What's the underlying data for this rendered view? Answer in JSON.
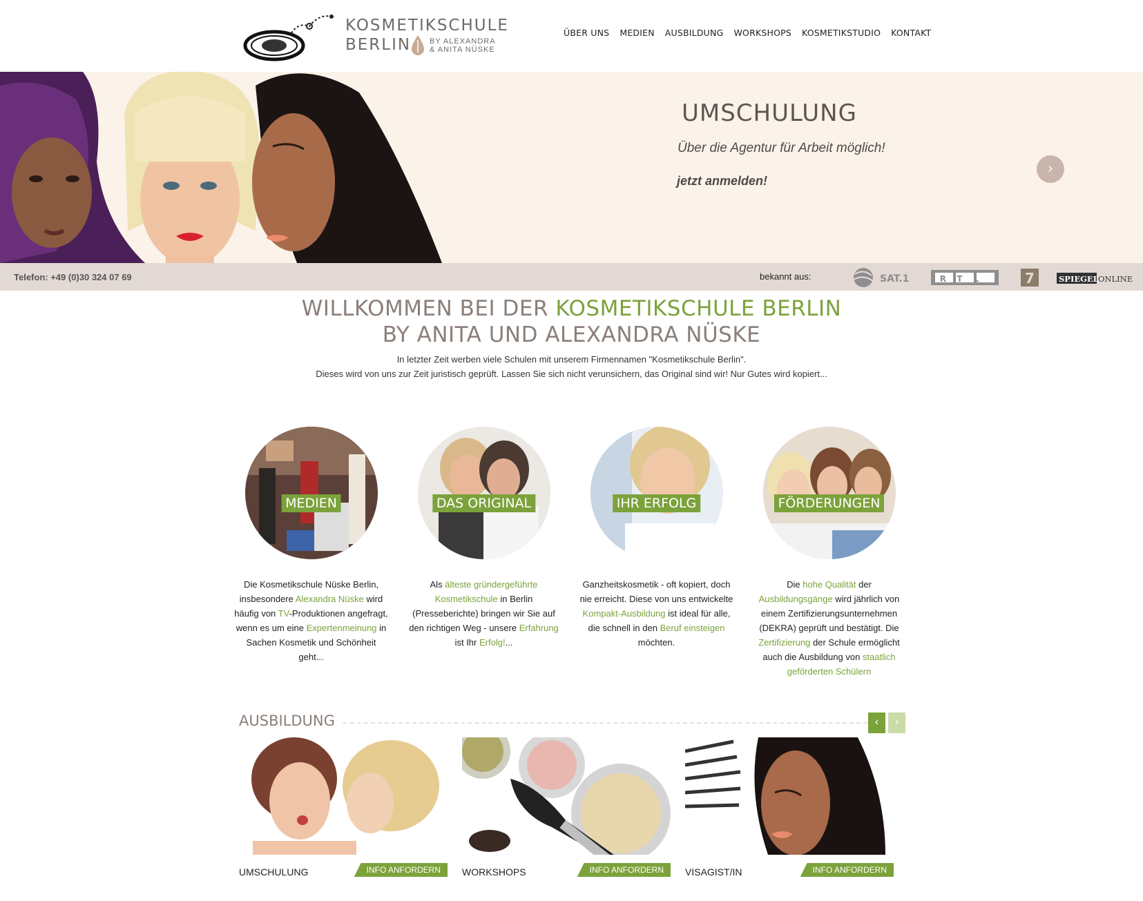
{
  "header": {
    "logo_title": "KOSMETIKSCHULE",
    "logo_city": "BERLIN",
    "logo_by_line1": "BY ALEXANDRA",
    "logo_by_line2": "& ANITA NÜSKE",
    "nav": [
      "ÜBER UNS",
      "MEDIEN",
      "AUSBILDUNG",
      "WORKSHOPS",
      "KOSMETIKSTUDIO",
      "KONTAKT"
    ]
  },
  "hero": {
    "title": "UMSCHULUNG",
    "subtitle": "Über die Agentur für Arbeit möglich!",
    "cta": "jetzt anmelden!",
    "next_icon": "chevron-right-icon"
  },
  "infobar": {
    "phone": "Telefon: +49 (0)30 324 07 69",
    "known_from": "bekannt aus:",
    "media": [
      "SAT.1",
      "RTL",
      "7",
      "SPIEGEL",
      "ONLINE"
    ]
  },
  "welcome": {
    "title_part1": "WILLKOMMEN BEI DER ",
    "title_part2": "KOSMETIKSCHULE BERLIN",
    "title_line2": "BY ANITA UND ALEXANDRA NÜSKE",
    "intro1": "In letzter Zeit werben viele Schulen mit unserem Firmennamen \"Kosmetikschule Berlin\".",
    "intro2": "Dieses wird von uns zur Zeit juristisch geprüft. Lassen Sie sich nicht verunsichern, das Original sind wir! Nur Gutes wird kopiert..."
  },
  "features": [
    {
      "label": "MEDIEN",
      "text": [
        [
          "Die Kosmetikschule Nüske Berlin, insbesondere ",
          false
        ],
        [
          "Alexandra Nüske",
          true
        ],
        [
          " wird häufig von ",
          false
        ],
        [
          "TV",
          true
        ],
        [
          "-Produktionen angefragt, wenn es um eine ",
          false
        ],
        [
          "Expertenmeinung",
          true
        ],
        [
          " in Sachen Kosmetik und Schönheit geht...",
          false
        ]
      ]
    },
    {
      "label": "DAS ORIGINAL",
      "text": [
        [
          "Als ",
          false
        ],
        [
          "älteste gründergeführte Kosmetikschule",
          true
        ],
        [
          " in Berlin (Presseberichte) bringen wir Sie auf den richtigen Weg - unsere ",
          false
        ],
        [
          "Erfahrung",
          true
        ],
        [
          " ist Ihr ",
          false
        ],
        [
          "Erfolg!",
          true
        ],
        [
          "...",
          false
        ]
      ]
    },
    {
      "label": "IHR ERFOLG",
      "text": [
        [
          "Ganzheitskosmetik - oft kopiert, doch nie erreicht. Diese von uns entwickelte ",
          false
        ],
        [
          "Kompakt-Ausbildung",
          true
        ],
        [
          " ist ideal für alle, die schnell in den ",
          false
        ],
        [
          "Beruf einsteigen",
          true
        ],
        [
          " möchten.",
          false
        ]
      ]
    },
    {
      "label": "FÖRDERUNGEN",
      "text": [
        [
          "Die ",
          false
        ],
        [
          "hohe Qualität",
          true
        ],
        [
          " der ",
          false
        ],
        [
          "Ausbildungsgänge",
          true
        ],
        [
          " wird jährlich von einem Zertifizierungsunternehmen (DEKRA) geprüft und bestätigt. Die ",
          false
        ],
        [
          "Zertifizierung",
          true
        ],
        [
          " der Schule ermöglicht auch die Ausbildung von ",
          false
        ],
        [
          "staatlich geförderten Schülern",
          true
        ]
      ]
    }
  ],
  "ausbildung": {
    "title": "AUSBILDUNG",
    "prev_icon": "chevron-left-icon",
    "next_icon": "chevron-right-icon",
    "cards": [
      {
        "name": "UMSCHULUNG",
        "button": "INFO ANFORDERN"
      },
      {
        "name": "WORKSHOPS",
        "button": "INFO ANFORDERN"
      },
      {
        "name": "VISAGIST/IN",
        "button": "INFO ANFORDERN"
      }
    ]
  },
  "colors": {
    "accent_green": "#7ca23b",
    "hero_bg": "#fbf2ea",
    "infobar_bg": "#e3d9d4",
    "heading_taupe": "#8a7f79"
  }
}
